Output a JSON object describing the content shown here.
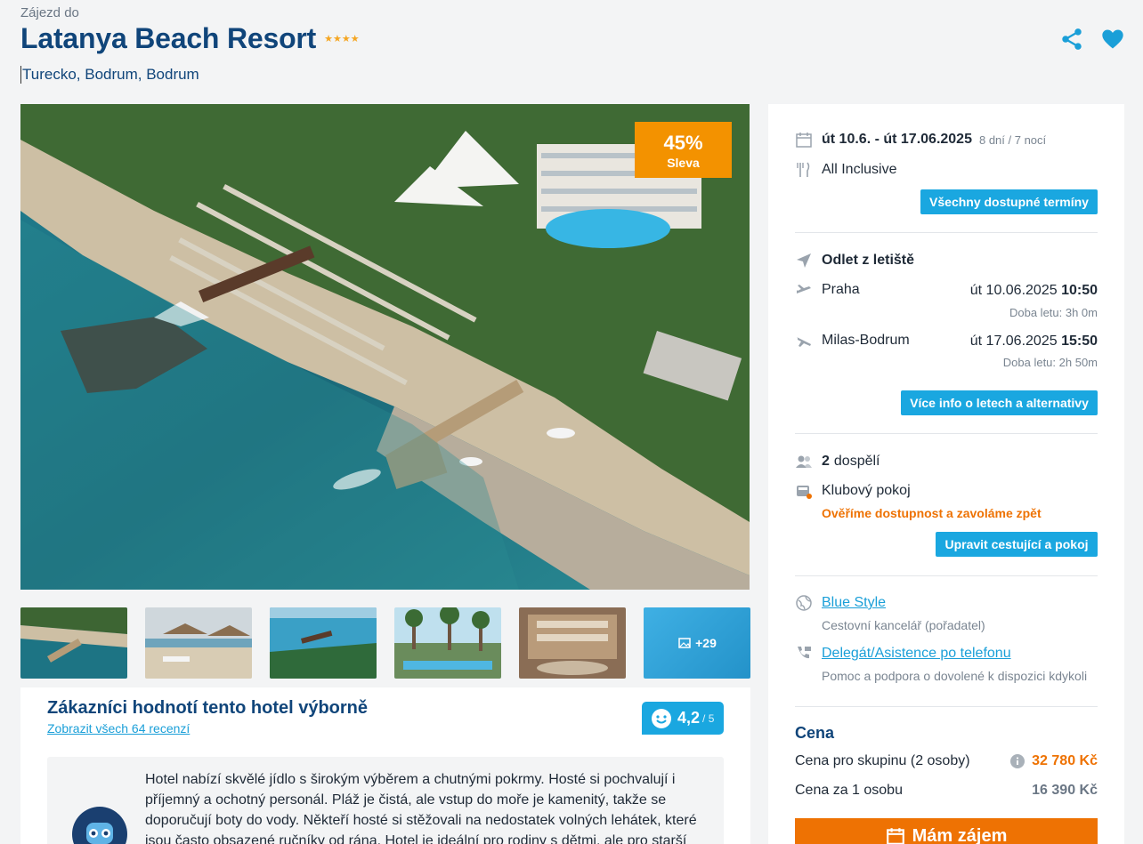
{
  "header": {
    "kicker": "Zájezd do",
    "hotel_name": "Latanya Beach Resort",
    "stars": "★★★★",
    "location": "Turecko, Bodrum, Bodrum"
  },
  "gallery": {
    "discount_percent": "45%",
    "discount_label": "Sleva",
    "more_photos": "+29"
  },
  "reviews": {
    "heading": "Zákazníci hodnotí tento hotel výborně",
    "link": "Zobrazit všech 64 recenzí",
    "rating": "4,2",
    "rating_max": "/ 5",
    "summary": "Hotel nabízí skvělé jídlo s širokým výběrem a chutnými pokrmy. Hosté si pochvalují i příjemný a ochotný personál. Pláž je čistá, ale vstup do moře je kamenitý, takže se doporučují boty do vody. Někteří hosté si stěžovali na nedostatek volných lehátek, které jsou často obsazené ručníky od rána. Hotel je ideální pro rodiny s dětmi, ale pro starší"
  },
  "trip": {
    "dates": "út 10.6. - út 17.06.2025",
    "duration": "8 dní / 7 nocí",
    "board": "All Inclusive",
    "terms_button": "Všechny dostupné termíny"
  },
  "flights": {
    "heading": "Odlet z letiště",
    "outbound_airport": "Praha",
    "outbound_date": "út 10.06.2025",
    "outbound_time": "10:50",
    "outbound_duration": "Doba letu: 3h 0m",
    "return_airport": "Milas-Bodrum",
    "return_date": "út 17.06.2025",
    "return_time": "15:50",
    "return_duration": "Doba letu: 2h 50m",
    "info_button": "Více info o letech a alternativy"
  },
  "travellers": {
    "count": "2",
    "label": "dospělí",
    "room": "Klubový pokoj",
    "availability_note": "Ověříme dostupnost a zavoláme zpět",
    "edit_button": "Upravit cestující a pokoj"
  },
  "organizer": {
    "agency_name": "Blue Style",
    "agency_role": "Cestovní kancelář (pořadatel)",
    "support_link": "Delegát/Asistence po telefonu",
    "support_desc": "Pomoc a podpora o dovolené k dispozici kdykoli"
  },
  "price": {
    "heading": "Cena",
    "group_label": "Cena pro skupinu (2 osoby)",
    "group_value": "32 780 Kč",
    "person_label": "Cena za 1 osobu",
    "person_value": "16 390 Kč",
    "cta_label": "Mám zájem"
  },
  "colors": {
    "brand_blue": "#10457a",
    "accent_blue": "#1aa7e0",
    "accent_orange": "#ee7203"
  }
}
